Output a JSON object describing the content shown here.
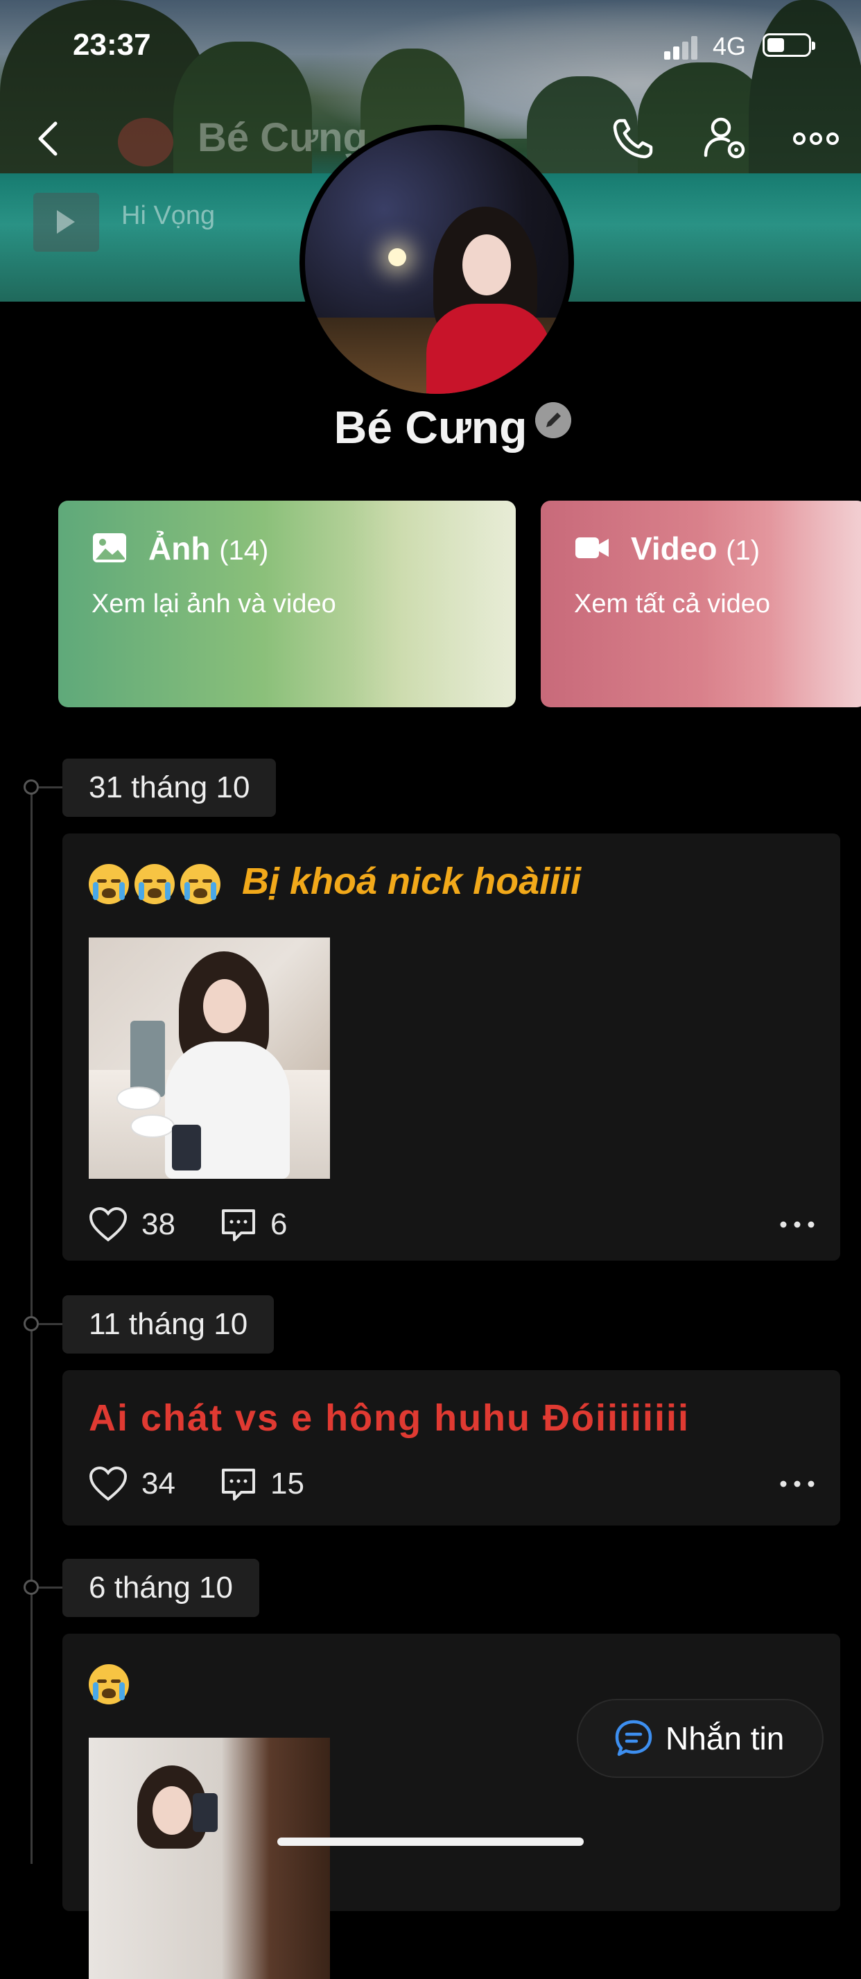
{
  "status_bar": {
    "time": "23:37",
    "network": "4G",
    "battery_percent": 35
  },
  "header": {
    "title": "Bé Cưng",
    "music_label": "Hi Vọng"
  },
  "profile": {
    "name": "Bé Cưng"
  },
  "media": {
    "photos": {
      "label": "Ảnh",
      "count": "(14)",
      "subtitle": "Xem lại ảnh và video"
    },
    "videos": {
      "label": "Video",
      "count": "(1)",
      "subtitle": "Xem tất cả video"
    }
  },
  "posts": [
    {
      "date": "31 tháng 10",
      "text": "Bị khoá nick hoàiiii",
      "text_color": "#f2a91a",
      "emoji_count": 3,
      "likes": "38",
      "comments": "6"
    },
    {
      "date": "11 tháng 10",
      "text": "Ai chát vs e hông huhu Đóiiiiiiii",
      "text_color": "#e03a32",
      "likes": "34",
      "comments": "15"
    },
    {
      "date": "6 tháng 10",
      "emoji_count": 1
    }
  ],
  "message_button": {
    "label": "Nhắn tin"
  },
  "colors": {
    "accent_blue": "#3d8ff0"
  }
}
